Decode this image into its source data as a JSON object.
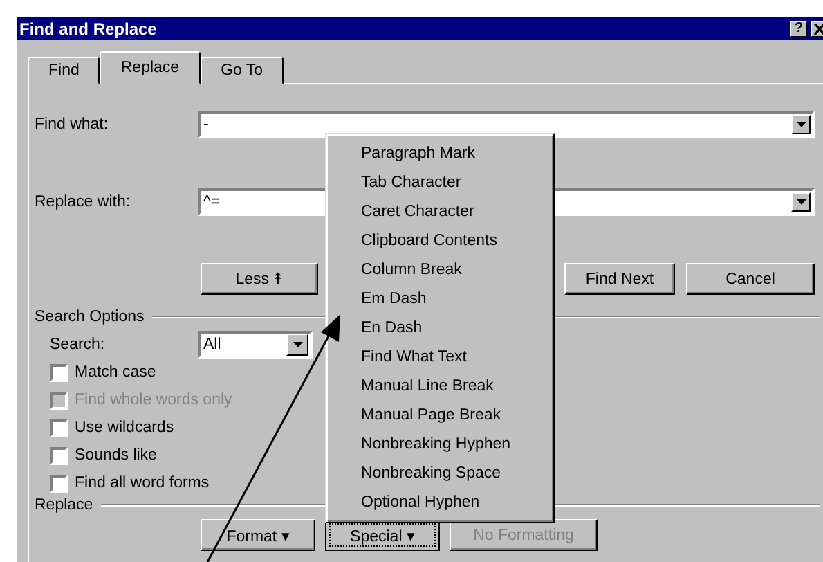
{
  "window": {
    "title": "Find and Replace",
    "help_button": "?"
  },
  "tabs": [
    {
      "label": "Find",
      "selected": false
    },
    {
      "label": "Replace",
      "selected": true
    },
    {
      "label": "Go To",
      "selected": false
    }
  ],
  "find_what": {
    "label": "Find what:",
    "value": "-"
  },
  "replace_with": {
    "label": "Replace with:",
    "value": "^="
  },
  "less_button": {
    "label": "Less ⯭"
  },
  "action_buttons": [
    {
      "label": "Find Next"
    },
    {
      "label": "Cancel"
    }
  ],
  "search_options": {
    "heading": "Search Options",
    "search_label": "Search:",
    "search_value": "All",
    "checkboxes": [
      {
        "label": "Match case",
        "checked": false,
        "disabled": false
      },
      {
        "label": "Find whole words only",
        "checked": false,
        "disabled": true
      },
      {
        "label": "Use wildcards",
        "checked": false,
        "disabled": false
      },
      {
        "label": "Sounds like",
        "checked": false,
        "disabled": false
      },
      {
        "label": "Find all word forms",
        "checked": false,
        "disabled": false
      }
    ]
  },
  "replace_section": {
    "heading": "Replace",
    "buttons": [
      {
        "label": "Format ▾",
        "disabled": false,
        "pressed": false
      },
      {
        "label": "Special ▾",
        "disabled": false,
        "pressed": true
      },
      {
        "label": "No Formatting",
        "disabled": true,
        "pressed": false
      }
    ]
  },
  "special_menu": {
    "items": [
      "Paragraph Mark",
      "Tab Character",
      "Caret Character",
      "Clipboard Contents",
      "Column Break",
      "Em Dash",
      "En Dash",
      "Find What Text",
      "Manual Line Break",
      "Manual Page Break",
      "Nonbreaking Hyphen",
      "Nonbreaking Space",
      "Optional Hyphen"
    ]
  }
}
